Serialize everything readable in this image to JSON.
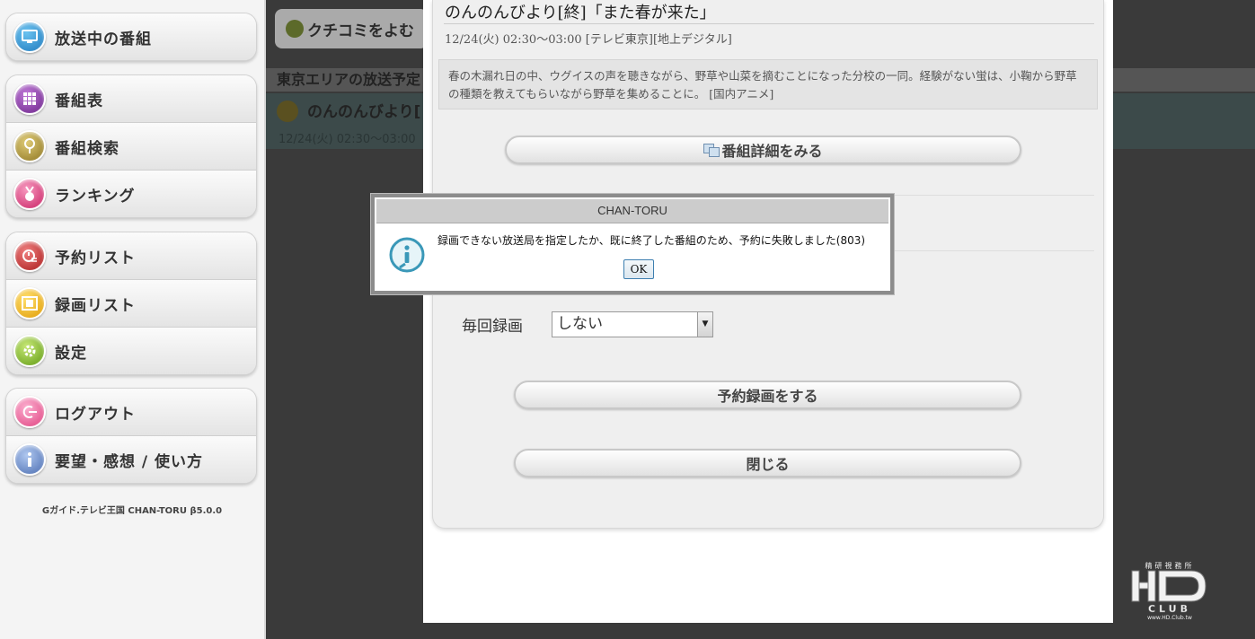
{
  "sidebar": {
    "groups": [
      [
        {
          "label": "放送中の番組",
          "icon": "tv-icon",
          "color": "#2b8fd0"
        }
      ],
      [
        {
          "label": "番組表",
          "icon": "grid-icon",
          "color": "#8a3aa8"
        },
        {
          "label": "番組検索",
          "icon": "search-icon",
          "color": "#b99830"
        },
        {
          "label": "ランキング",
          "icon": "medal-icon",
          "color": "#e0457f"
        }
      ],
      [
        {
          "label": "予約リスト",
          "icon": "clock-list-icon",
          "color": "#cc2a2a"
        },
        {
          "label": "録画リスト",
          "icon": "film-icon",
          "color": "#f0b000"
        },
        {
          "label": "設定",
          "icon": "gear-icon",
          "color": "#7fb52a"
        }
      ],
      [
        {
          "label": "ログアウト",
          "icon": "logout-icon",
          "color": "#e85a9a"
        },
        {
          "label": "要望・感想 / 使い方",
          "icon": "info-icon",
          "color": "#5a7fc0"
        }
      ]
    ],
    "footer": "Gガイド.テレビ王国 CHAN-TORU β5.0.0"
  },
  "background": {
    "kuchikomi_label": "クチコミをよむ",
    "area_title": "東京エリアの放送予定",
    "program_title": "のんのんびより[",
    "program_time": "12/24(火) 02:30〜03:00"
  },
  "program": {
    "title": "のんのんびより[終]「また春が来た」",
    "time": "12/24(火) 02:30〜03:00 [テレビ東京][地上デジタル]",
    "description": "春の木漏れ日の中、ウグイスの声を聴きながら、野草や山菜を摘むことになった分校の一同。経験がない蛍は、小鞠から野草の種類を教えてもらいながら野草を集めることに。 [国内アニメ]",
    "detail_button": "番組詳細をみる",
    "repeat_label": "毎回録画",
    "repeat_value": "しない",
    "reserve_button": "予約録画をする",
    "close_button": "閉じる"
  },
  "dialog": {
    "title": "CHAN-TORU",
    "message": "録画できない放送局を指定したか、既に終了した番組のため、予約に失敗しました(803)",
    "ok_label": "OK",
    "icon": "info-icon"
  },
  "watermark": {
    "top_text": "精研視務所",
    "bottom_text": "www.HD.Club.tw"
  }
}
